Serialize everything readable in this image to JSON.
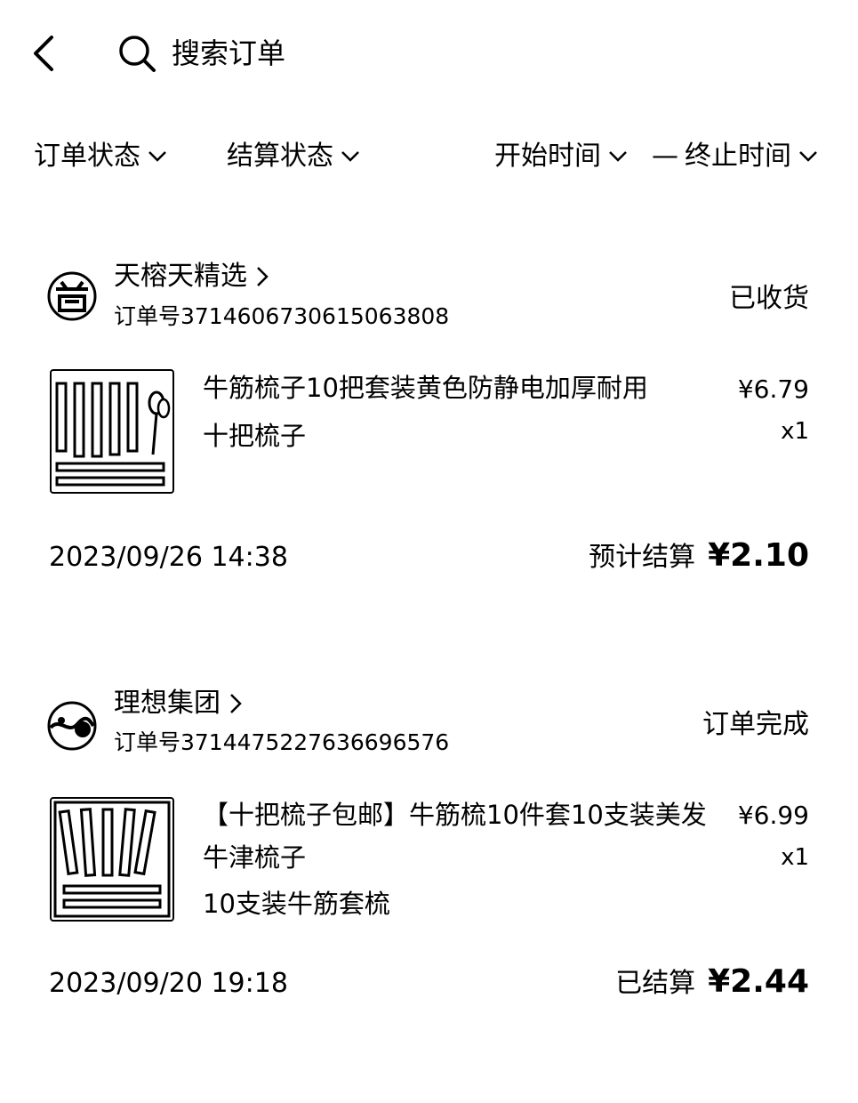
{
  "header": {
    "search_label": "搜索订单"
  },
  "filters": {
    "order_status": "订单状态",
    "settle_status": "结算状态",
    "start_time": "开始时间",
    "separator": "—",
    "end_time": "终止时间"
  },
  "orders": [
    {
      "store_name": "天榕天精选",
      "order_no": "订单号3714606730615063808",
      "status": "已收货",
      "product_title": "牛筋梳子10把套装黄色防静电加厚耐用",
      "sku": "十把梳子",
      "price": "¥6.79",
      "qty": "x1",
      "time": "2023/09/26 14:38",
      "settle_label": "预计结算",
      "settle_amount": "¥2.10"
    },
    {
      "store_name": "理想集团",
      "order_no": "订单号3714475227636696576",
      "status": "订单完成",
      "product_title": "【十把梳子包邮】牛筋梳10件套10支装美发牛津梳子",
      "sku": "10支装牛筋套梳",
      "price": "¥6.99",
      "qty": "x1",
      "time": "2023/09/20 19:18",
      "settle_label": "已结算",
      "settle_amount": "¥2.44"
    }
  ],
  "icons": {
    "back": "chevron-left-icon",
    "search": "search-icon",
    "dropdown": "chevron-down-icon",
    "store_link": "chevron-right-icon"
  }
}
